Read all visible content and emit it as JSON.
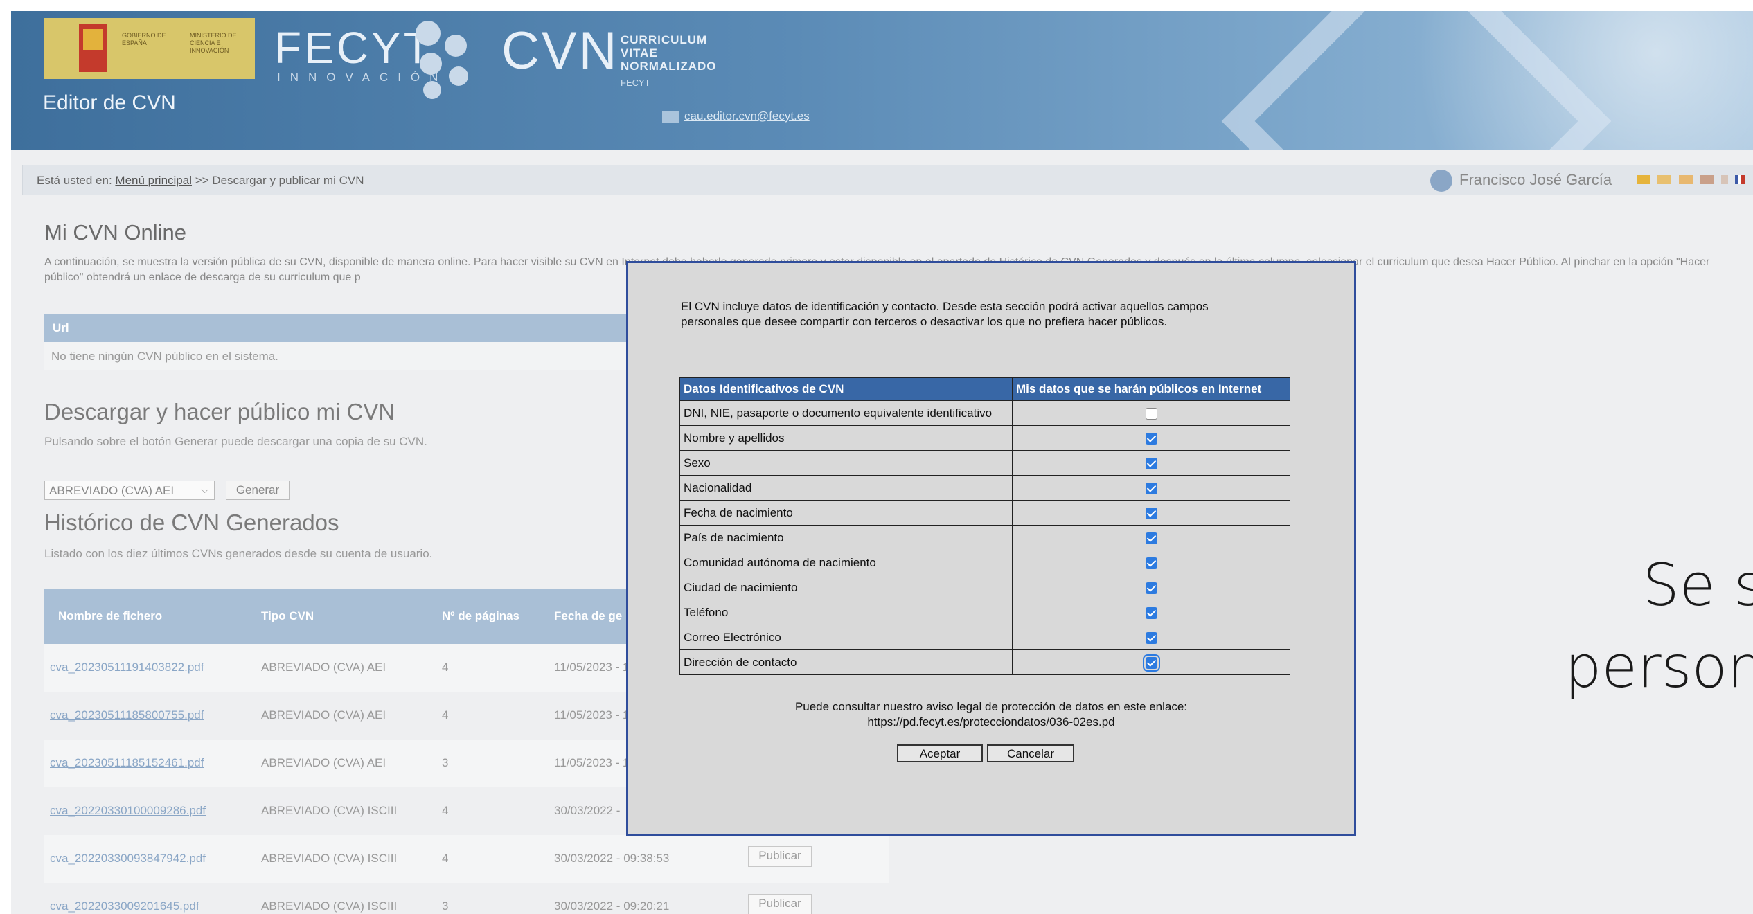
{
  "header": {
    "gov_line1": "GOBIERNO DE ESPAÑA",
    "gov_line2": "MINISTERIO DE CIENCIA E INNOVACIÓN",
    "fecyt": "FECYT",
    "fecyt_sub": "INNOVACIÓN",
    "cvn": "CVN",
    "cvn_sub": "CURRICULUM VITAE NORMALIZADO",
    "cvn_sub2": "FECYT",
    "editor_title": "Editor de CVN",
    "mail": "cau.editor.cvn@fecyt.es"
  },
  "breadcrumb": {
    "prefix": "Está usted en:",
    "link": "Menú principal",
    "current": ">> Descargar y publicar mi CVN"
  },
  "user": {
    "name": "Francisco José García"
  },
  "online": {
    "title": "Mi CVN Online",
    "intro": "A continuación, se muestra la versión pública de su CVN, disponible de manera online. Para hacer visible su CVN en Internet debe haberlo generado primero y estar disponible en el apartado de Histórico de CVN Generados y después en la última columna, seleccionar el curriculum que desea Hacer Público. Al pinchar en la opción \"Hacer público\" obtendrá un enlace de descarga de su curriculum que p",
    "url_header": "Url",
    "url_empty": "No tiene ningún CVN público en el sistema."
  },
  "download": {
    "title": "Descargar y hacer público mi CVN",
    "desc": "Pulsando sobre el botón Generar puede descargar una copia de su CVN.",
    "select_value": "ABREVIADO (CVA) AEI",
    "generate": "Generar"
  },
  "history": {
    "title": "Histórico de CVN Generados",
    "desc": "Listado con los diez últimos CVNs generados desde su cuenta de usuario.",
    "columns": [
      "Nombre de fichero",
      "Tipo CVN",
      "Nº de páginas",
      "Fecha de ge"
    ],
    "rows": [
      {
        "file": "cva_20230511191403822.pdf",
        "type": "ABREVIADO (CVA) AEI",
        "pages": "4",
        "date": "11/05/2023 - 1",
        "action": ""
      },
      {
        "file": "cva_20230511185800755.pdf",
        "type": "ABREVIADO (CVA) AEI",
        "pages": "4",
        "date": "11/05/2023 - 1",
        "action": ""
      },
      {
        "file": "cva_20230511185152461.pdf",
        "type": "ABREVIADO (CVA) AEI",
        "pages": "3",
        "date": "11/05/2023 - 1",
        "action": ""
      },
      {
        "file": "cva_20220330100009286.pdf",
        "type": "ABREVIADO (CVA) ISCIII",
        "pages": "4",
        "date": "30/03/2022 -",
        "action": ""
      },
      {
        "file": "cva_20220330093847942.pdf",
        "type": "ABREVIADO (CVA) ISCIII",
        "pages": "4",
        "date": "30/03/2022 - 09:38:53",
        "action": "Publicar"
      },
      {
        "file": "cva_2022033009201645.pdf",
        "type": "ABREVIADO (CVA) ISCIII",
        "pages": "3",
        "date": "30/03/2022 - 09:20:21",
        "action": "Publicar"
      }
    ]
  },
  "side_text": {
    "line1": "Se s",
    "line2": "person"
  },
  "dialog": {
    "intro": "El CVN incluye datos de identificación y contacto. Desde esta sección podrá activar aquellos campos personales que desee compartir con terceros o desactivar los que no prefiera hacer públicos.",
    "col1": "Datos Identificativos de CVN",
    "col2": "Mis datos que se harán públicos en Internet",
    "rows": [
      {
        "label": "DNI, NIE, pasaporte o documento equivalente identificativo",
        "checked": false
      },
      {
        "label": "Nombre y apellidos",
        "checked": true
      },
      {
        "label": "Sexo",
        "checked": true
      },
      {
        "label": "Nacionalidad",
        "checked": true
      },
      {
        "label": "Fecha de nacimiento",
        "checked": true
      },
      {
        "label": "País de nacimiento",
        "checked": true
      },
      {
        "label": "Comunidad autónoma de nacimiento",
        "checked": true
      },
      {
        "label": "Ciudad de nacimiento",
        "checked": true
      },
      {
        "label": "Teléfono",
        "checked": true
      },
      {
        "label": "Correo Electrónico",
        "checked": true
      },
      {
        "label": "Dirección de contacto",
        "checked": true
      }
    ],
    "legal_text": "Puede consultar nuestro aviso legal de protección de datos en este enlace:",
    "legal_url": "https://pd.fecyt.es/protecciondatos/036-02es.pd",
    "accept": "Aceptar",
    "cancel": "Cancelar"
  },
  "colors": {
    "header": "#3e6f9c",
    "table_header": "#a9bfd6",
    "dialog_border": "#2f4d9c",
    "dialog_th": "#3867a6",
    "checkbox": "#2d7be0"
  }
}
